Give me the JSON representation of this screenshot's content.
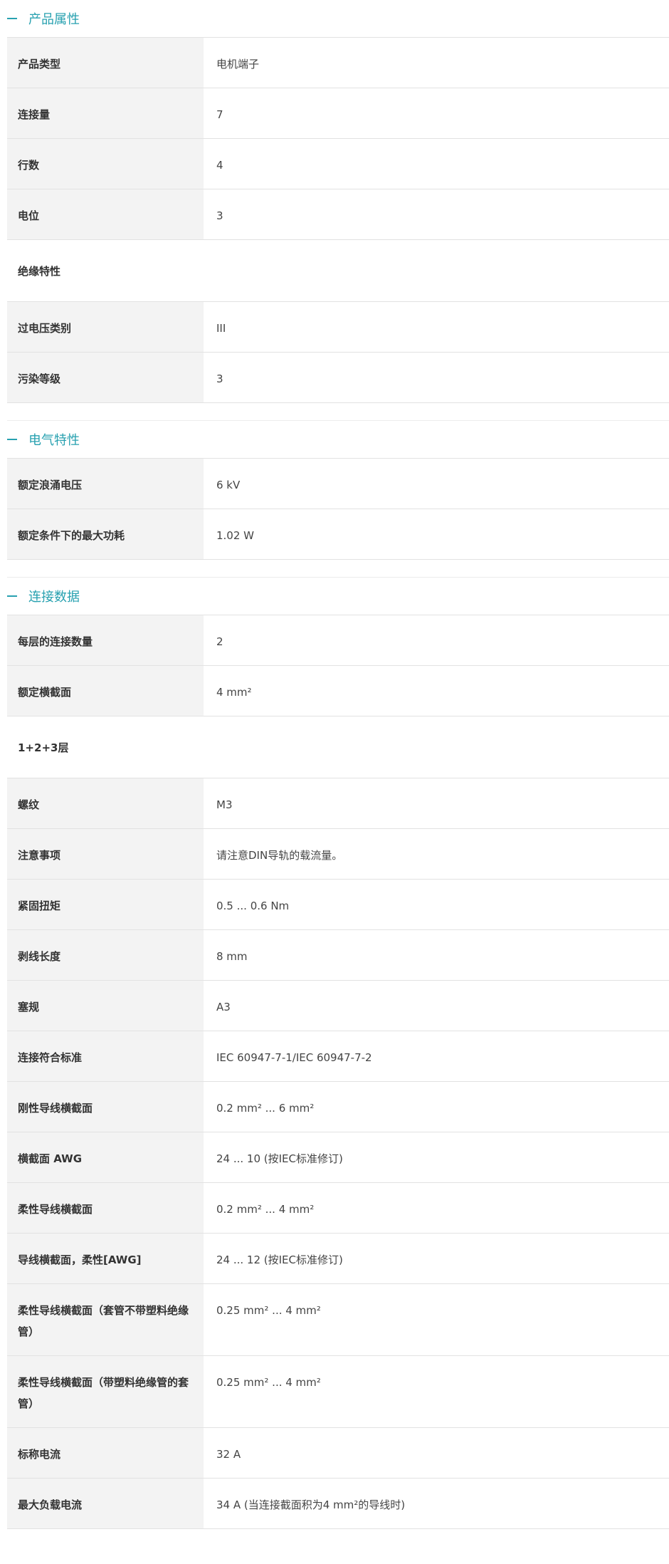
{
  "sections": {
    "product": {
      "title": "产品属性",
      "rows": [
        {
          "label": "产品类型",
          "value": "电机端子"
        },
        {
          "label": "连接量",
          "value": "7"
        },
        {
          "label": "行数",
          "value": "4"
        },
        {
          "label": "电位",
          "value": "3"
        }
      ],
      "subgroup": "绝缘特性",
      "rows2": [
        {
          "label": "过电压类别",
          "value": "III"
        },
        {
          "label": "污染等级",
          "value": "3"
        }
      ]
    },
    "electrical": {
      "title": "电气特性",
      "rows": [
        {
          "label": "额定浪涌电压",
          "value": "6 kV"
        },
        {
          "label": "额定条件下的最大功耗",
          "value": "1.02 W"
        }
      ]
    },
    "connection": {
      "title": "连接数据",
      "rows": [
        {
          "label": "每层的连接数量",
          "value": "2"
        },
        {
          "label": "额定横截面",
          "value": "4 mm²"
        }
      ],
      "subgroup": "1+2+3层",
      "rows2": [
        {
          "label": "螺纹",
          "value": "M3"
        },
        {
          "label": "注意事项",
          "value": "请注意DIN导轨的载流量。"
        },
        {
          "label": "紧固扭矩",
          "value": "0.5 ... 0.6 Nm"
        },
        {
          "label": "剥线长度",
          "value": "8 mm"
        },
        {
          "label": "塞规",
          "value": "A3"
        },
        {
          "label": "连接符合标准",
          "value": "IEC 60947-7-1/IEC 60947-7-2"
        },
        {
          "label": "刚性导线横截面",
          "value": "0.2 mm² ... 6 mm²"
        },
        {
          "label": "横截面 AWG",
          "value": "24 ... 10 (按IEC标准修订)"
        },
        {
          "label": "柔性导线横截面",
          "value": "0.2 mm² ... 4 mm²"
        },
        {
          "label": "导线横截面，柔性[AWG]",
          "value": "24 ... 12 (按IEC标准修订)"
        },
        {
          "label": "柔性导线横截面（套管不带塑料绝缘管）",
          "value": "0.25 mm² ... 4 mm²"
        },
        {
          "label": "柔性导线横截面（带塑料绝缘管的套管）",
          "value": "0.25 mm² ... 4 mm²"
        },
        {
          "label": "标称电流",
          "value": "32 A"
        },
        {
          "label": "最大负载电流",
          "value": "34 A (当连接截面积为4 mm²的导线时)"
        }
      ]
    }
  },
  "colors": {
    "accent": "#28a1b0",
    "label_bg": "#f3f3f3",
    "border": "#e2e2e2"
  }
}
